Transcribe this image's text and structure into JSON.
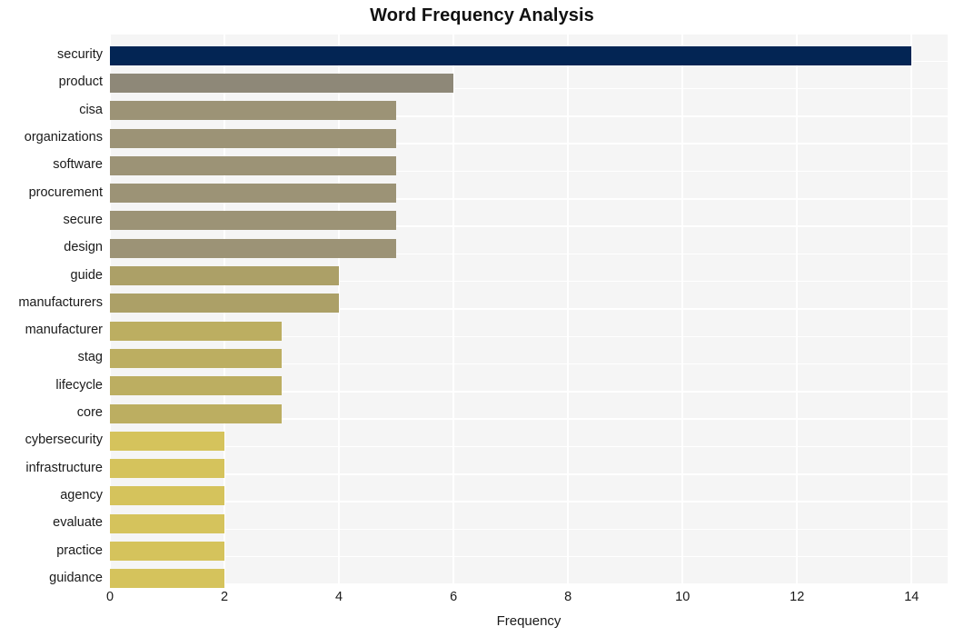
{
  "chart_data": {
    "type": "bar",
    "orientation": "horizontal",
    "title": "Word Frequency Analysis",
    "xlabel": "Frequency",
    "ylabel": "",
    "xlim": [
      0,
      14.63
    ],
    "xticks": [
      0,
      2,
      4,
      6,
      8,
      10,
      12,
      14
    ],
    "xtick_labels": [
      "0",
      "2",
      "4",
      "6",
      "8",
      "10",
      "12",
      "14"
    ],
    "grid": true,
    "grid_color": "#ffffff",
    "plot_background": "#f5f5f5",
    "page_background": "#ffffff",
    "legend": null,
    "categories": [
      "security",
      "product",
      "cisa",
      "organizations",
      "software",
      "procurement",
      "secure",
      "design",
      "guide",
      "manufacturers",
      "manufacturer",
      "stag",
      "lifecycle",
      "core",
      "cybersecurity",
      "infrastructure",
      "agency",
      "evaluate",
      "practice",
      "guidance"
    ],
    "values": [
      14,
      6,
      5,
      5,
      5,
      5,
      5,
      5,
      4,
      4,
      3,
      3,
      3,
      3,
      2,
      2,
      2,
      2,
      2,
      2
    ],
    "bar_colors": [
      "#032554",
      "#8e8878",
      "#9c9376",
      "#9c9376",
      "#9c9376",
      "#9c9376",
      "#9c9376",
      "#9c9376",
      "#aca067",
      "#aca067",
      "#bcae61",
      "#bcae61",
      "#bcae61",
      "#bcae61",
      "#d5c35c",
      "#d5c35c",
      "#d5c35c",
      "#d5c35c",
      "#d5c35c",
      "#d5c35c"
    ]
  }
}
